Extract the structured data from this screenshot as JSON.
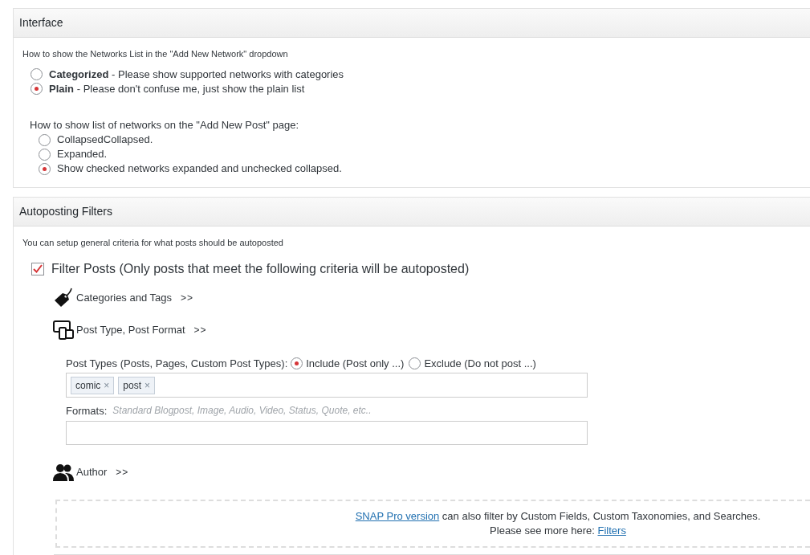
{
  "panels": [
    {
      "title": "Interface",
      "sections": [
        {
          "kind": "note",
          "text": "How to show the Networks List in the \"Add New Network\" dropdown"
        },
        {
          "kind": "radios",
          "options": [
            {
              "label": "Categorized",
              "desc": " - Please show supported networks with categories",
              "selected": false
            },
            {
              "label": "Plain",
              "desc": " - Please don't confuse me, just show the plain list",
              "selected": true
            }
          ]
        },
        {
          "kind": "question",
          "text": "How to show list of networks on the \"Add New Post\" page:"
        },
        {
          "kind": "radios2",
          "options": [
            {
              "label": "CollapsedCollapsed.",
              "selected": false
            },
            {
              "label": "Expanded.",
              "selected": false
            },
            {
              "label": "Show checked networks expanded and unchecked collapsed.",
              "selected": true
            }
          ]
        }
      ]
    },
    {
      "title": "Autoposting Filters",
      "sections": [
        {
          "kind": "note",
          "text": "You can setup general criteria for what posts should be autoposted"
        },
        {
          "kind": "filter",
          "label": "Filter Posts (Only posts that meet the following criteria will be autoposted)",
          "checked": true
        },
        {
          "kind": "group",
          "label": "Categories and Tags",
          "toggle": ">>"
        },
        {
          "kind": "group",
          "label": "Post Type, Post Format",
          "toggle": ">>"
        },
        {
          "kind": "posttypes",
          "label": "Post Types (Posts, Pages, Custom Post Types):",
          "options": [
            {
              "label": "Include (Post only ...)",
              "selected": true
            },
            {
              "label": "Exclude (Do not post ...)",
              "selected": false
            }
          ],
          "tokens": [
            {
              "text": "comic",
              "remove": "×"
            },
            {
              "text": "post",
              "remove": "×"
            }
          ]
        },
        {
          "kind": "formats",
          "label": "Formats:",
          "hint": "Standard Blogpost, Image, Audio, Video, Status, Quote, etc.."
        },
        {
          "kind": "group",
          "label": "Author",
          "toggle": ">>"
        },
        {
          "kind": "pro",
          "lines": [
            [
              {
                "kind": "link",
                "text": "SNAP Pro version"
              },
              {
                "kind": "text",
                "text": " can also filter by Custom Fields, Custom Taxonomies, and Searches."
              }
            ],
            [
              {
                "kind": "text",
                "text": "Please see more here: "
              },
              {
                "kind": "link",
                "text": "Filters"
              }
            ]
          ]
        }
      ]
    }
  ]
}
